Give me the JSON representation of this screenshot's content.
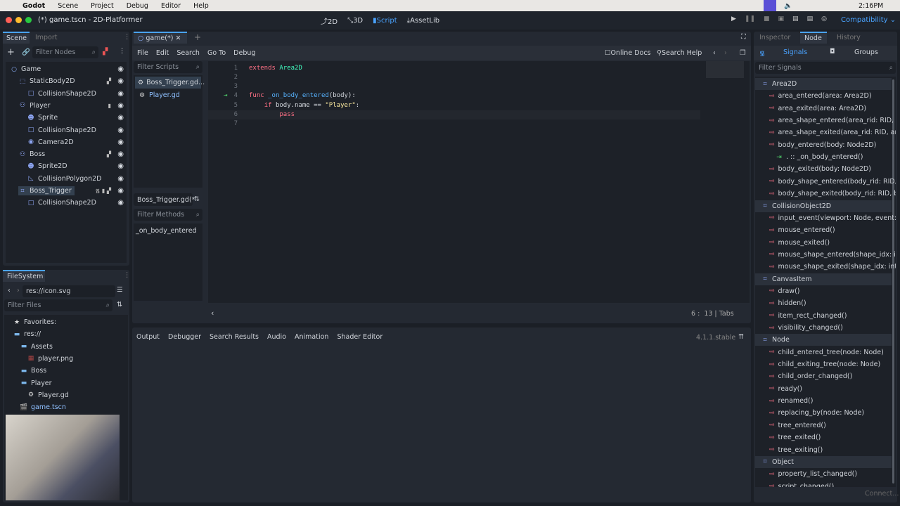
{
  "macbar": {
    "app": "Godot",
    "menus": [
      "Scene",
      "Project",
      "Debug",
      "Editor",
      "Help"
    ],
    "time": "2:16PM"
  },
  "window": {
    "title": "(*) game.tscn - 2D-Platformer",
    "workspaces": [
      "2D",
      "3D",
      "Script",
      "AssetLib"
    ],
    "active_workspace": "Script",
    "renderer": "Compatibility"
  },
  "scene_dock": {
    "tabs": [
      "Scene",
      "Import"
    ],
    "filter_placeholder": "Filter Nodes",
    "nodes": [
      {
        "name": "Game",
        "depth": 0,
        "icon": "node-circle-icon",
        "color": "#8fb3ff"
      },
      {
        "name": "StaticBody2D",
        "depth": 1,
        "icon": "static-body-icon",
        "color": "#8da5f3",
        "extra": "group"
      },
      {
        "name": "CollisionShape2D",
        "depth": 2,
        "icon": "collision-shape-icon",
        "color": "#8da5f3"
      },
      {
        "name": "Player",
        "depth": 1,
        "icon": "character-body-icon",
        "color": "#8da5f3",
        "extra": "script"
      },
      {
        "name": "Sprite",
        "depth": 2,
        "icon": "sprite-icon",
        "color": "#8da5f3"
      },
      {
        "name": "CollisionShape2D",
        "depth": 2,
        "icon": "collision-shape-icon",
        "color": "#8da5f3"
      },
      {
        "name": "Camera2D",
        "depth": 2,
        "icon": "camera-icon",
        "color": "#8da5f3"
      },
      {
        "name": "Boss",
        "depth": 1,
        "icon": "character-body-icon",
        "color": "#8da5f3",
        "extra": "group"
      },
      {
        "name": "Sprite2D",
        "depth": 2,
        "icon": "sprite-icon",
        "color": "#8da5f3"
      },
      {
        "name": "CollisionPolygon2D",
        "depth": 2,
        "icon": "collision-polygon-icon",
        "color": "#8da5f3"
      },
      {
        "name": "Boss_Trigger",
        "depth": 1,
        "icon": "area2d-icon",
        "color": "#8da5f3",
        "extra": "signal-script-group",
        "selected": true
      },
      {
        "name": "CollisionShape2D",
        "depth": 2,
        "icon": "collision-shape-icon",
        "color": "#8da5f3"
      }
    ]
  },
  "filesystem": {
    "title": "FileSystem",
    "path": "res://icon.svg",
    "filter_placeholder": "Filter Files",
    "items": [
      {
        "name": "Favorites:",
        "depth": 0,
        "icon": "star-icon"
      },
      {
        "name": "res://",
        "depth": 0,
        "icon": "folder-icon"
      },
      {
        "name": "Assets",
        "depth": 1,
        "icon": "folder-icon"
      },
      {
        "name": "player.png",
        "depth": 2,
        "icon": "image-icon"
      },
      {
        "name": "Boss",
        "depth": 1,
        "icon": "folder-icon"
      },
      {
        "name": "Player",
        "depth": 1,
        "icon": "folder-icon"
      },
      {
        "name": "Player.gd",
        "depth": 2,
        "icon": "gear-icon"
      },
      {
        "name": "game.tscn",
        "depth": 1,
        "icon": "scene-icon",
        "highlight": true
      }
    ]
  },
  "script_editor": {
    "tab": "game(*)",
    "menus": [
      "File",
      "Edit",
      "Search",
      "Go To",
      "Debug"
    ],
    "online_docs": "Online Docs",
    "search_help": "Search Help",
    "filter_scripts": "Filter Scripts",
    "scripts": [
      "Boss_Trigger.gd...",
      "Player.gd"
    ],
    "current_script": "Boss_Trigger.gd(*",
    "filter_methods": "Filter Methods",
    "methods": [
      "_on_body_entered"
    ],
    "code": [
      {
        "n": "1",
        "html": "<span class='kw'>extends</span> <span class='ty'>Area2D</span>"
      },
      {
        "n": "2",
        "html": ""
      },
      {
        "n": "3",
        "html": ""
      },
      {
        "n": "4",
        "html": "<span class='kw'>func</span> <span class='fn'>_on_body_entered</span>(body):"
      },
      {
        "n": "5",
        "html": "    <span class='kw'>if</span> body.name == <span class='str'>\"Player\"</span>:"
      },
      {
        "n": "6",
        "html": "        <span class='kw'>pass</span>"
      },
      {
        "n": "7",
        "html": ""
      }
    ],
    "status": {
      "line": "6",
      "col": "13",
      "indent": "Tabs"
    }
  },
  "bottom_panel": {
    "tabs": [
      "Output",
      "Debugger",
      "Search Results",
      "Audio",
      "Animation",
      "Shader Editor"
    ],
    "version": "4.1.1.stable"
  },
  "right_dock": {
    "tabs": [
      "Inspector",
      "Node",
      "History"
    ],
    "subtabs": [
      "Signals",
      "Groups"
    ],
    "filter_placeholder": "Filter Signals",
    "connect": "Connect...",
    "signals": [
      {
        "t": "h",
        "text": "Area2D"
      },
      {
        "t": "s",
        "text": "area_entered(area: Area2D)"
      },
      {
        "t": "s",
        "text": "area_exited(area: Area2D)"
      },
      {
        "t": "s",
        "text": "area_shape_entered(area_rid: RID, area"
      },
      {
        "t": "s",
        "text": "area_shape_exited(area_rid: RID, area:"
      },
      {
        "t": "s",
        "text": "body_entered(body: Node2D)"
      },
      {
        "t": "c",
        "text": ". :: _on_body_entered()"
      },
      {
        "t": "s",
        "text": "body_exited(body: Node2D)"
      },
      {
        "t": "s",
        "text": "body_shape_entered(body_rid: RID, bo"
      },
      {
        "t": "s",
        "text": "body_shape_exited(body_rid: RID, bod"
      },
      {
        "t": "h",
        "text": "CollisionObject2D"
      },
      {
        "t": "s",
        "text": "input_event(viewport: Node, event: Inp"
      },
      {
        "t": "s",
        "text": "mouse_entered()"
      },
      {
        "t": "s",
        "text": "mouse_exited()"
      },
      {
        "t": "s",
        "text": "mouse_shape_entered(shape_idx: int)"
      },
      {
        "t": "s",
        "text": "mouse_shape_exited(shape_idx: int)"
      },
      {
        "t": "h",
        "text": "CanvasItem"
      },
      {
        "t": "s",
        "text": "draw()"
      },
      {
        "t": "s",
        "text": "hidden()"
      },
      {
        "t": "s",
        "text": "item_rect_changed()"
      },
      {
        "t": "s",
        "text": "visibility_changed()"
      },
      {
        "t": "h",
        "text": "Node"
      },
      {
        "t": "s",
        "text": "child_entered_tree(node: Node)"
      },
      {
        "t": "s",
        "text": "child_exiting_tree(node: Node)"
      },
      {
        "t": "s",
        "text": "child_order_changed()"
      },
      {
        "t": "s",
        "text": "ready()"
      },
      {
        "t": "s",
        "text": "renamed()"
      },
      {
        "t": "s",
        "text": "replacing_by(node: Node)"
      },
      {
        "t": "s",
        "text": "tree_entered()"
      },
      {
        "t": "s",
        "text": "tree_exited()"
      },
      {
        "t": "s",
        "text": "tree_exiting()"
      },
      {
        "t": "h",
        "text": "Object"
      },
      {
        "t": "s",
        "text": "property_list_changed()"
      },
      {
        "t": "s",
        "text": "script_changed()"
      }
    ]
  },
  "colors": {
    "accent": "#4aa3ff",
    "signal": "#ff7085",
    "keyword": "#ff7085",
    "type": "#42ffc2",
    "string": "#ffeda1"
  }
}
